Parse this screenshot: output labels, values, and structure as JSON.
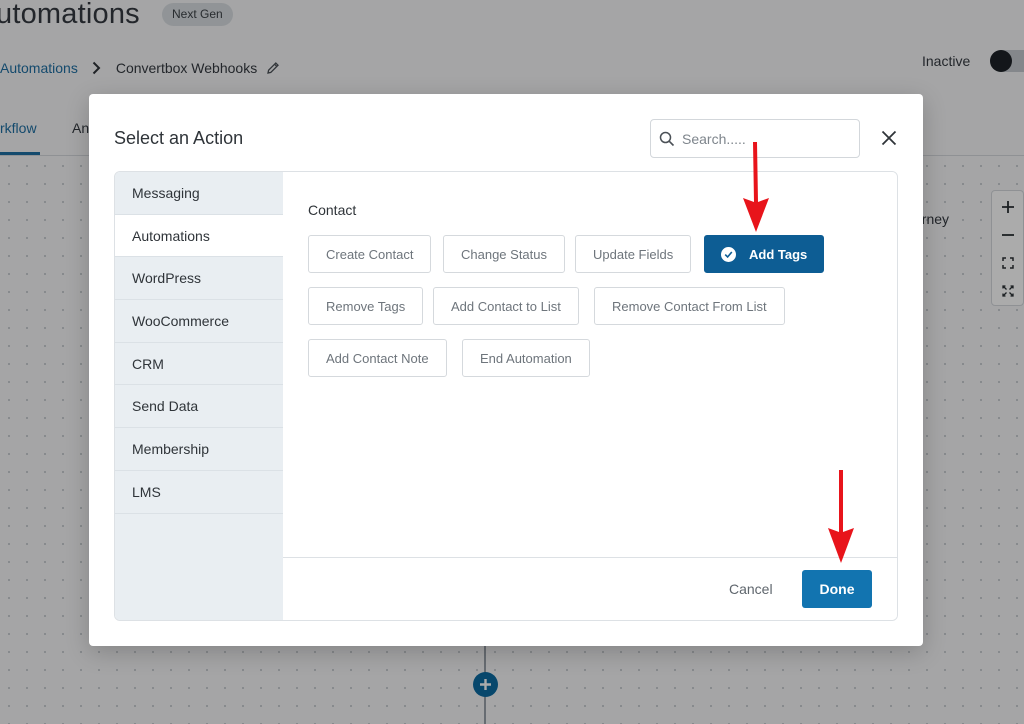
{
  "header": {
    "title": "utomations",
    "badge": "Next Gen",
    "breadcrumb": {
      "parent": "Automations",
      "current": "Convertbox Webhooks"
    },
    "status_label": "Inactive"
  },
  "tabs": [
    {
      "label": "rkflow",
      "active": true
    },
    {
      "label": "An",
      "active": false
    }
  ],
  "canvas": {
    "partial_node_text": "urney"
  },
  "modal": {
    "title": "Select an Action",
    "search": {
      "placeholder": "Search.....",
      "value": ""
    },
    "sidebar": {
      "items": [
        {
          "label": "Messaging",
          "active": false
        },
        {
          "label": "Automations",
          "active": true
        },
        {
          "label": "WordPress",
          "active": false
        },
        {
          "label": "WooCommerce",
          "active": false
        },
        {
          "label": "CRM",
          "active": false
        },
        {
          "label": "Send Data",
          "active": false
        },
        {
          "label": "Membership",
          "active": false
        },
        {
          "label": "LMS",
          "active": false
        }
      ]
    },
    "section": {
      "title": "Contact",
      "actions": [
        {
          "label": "Create Contact",
          "selected": false
        },
        {
          "label": "Change Status",
          "selected": false
        },
        {
          "label": "Update Fields",
          "selected": false
        },
        {
          "label": "Add Tags",
          "selected": true
        },
        {
          "label": "Remove Tags",
          "selected": false
        },
        {
          "label": "Add Contact to List",
          "selected": false
        },
        {
          "label": "Remove Contact From List",
          "selected": false
        },
        {
          "label": "Add Contact Note",
          "selected": false
        },
        {
          "label": "End Automation",
          "selected": false
        }
      ]
    },
    "footer": {
      "cancel_label": "Cancel",
      "done_label": "Done"
    }
  },
  "colors": {
    "primary": "#1274b0",
    "selected_action": "#0d5d94",
    "link": "#1f6fa3",
    "annotation_arrow": "#e8141b"
  }
}
